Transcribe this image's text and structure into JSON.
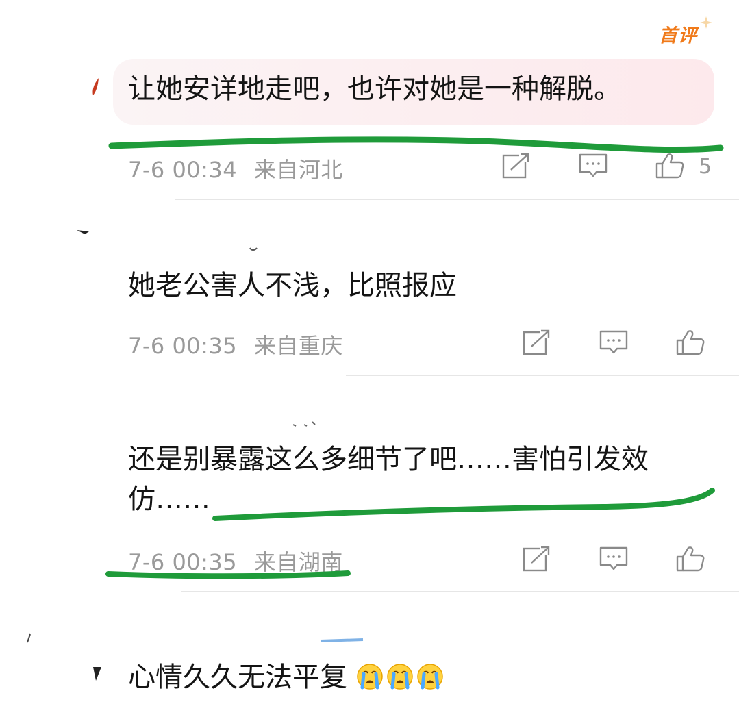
{
  "comments": [
    {
      "badge": "首评",
      "text": "让她安详地走吧，也许对她是一种解脱。",
      "time": "7-6 00:34",
      "location": "来自河北",
      "likes": "5"
    },
    {
      "text": "她老公害人不浅，比照报应",
      "time": "7-6 00:35",
      "location": "来自重庆"
    },
    {
      "text": "还是别暴露这么多细节了吧……害怕引发效仿……",
      "time": "7-6 00:35",
      "location": "来自湖南"
    },
    {
      "text": "心情久久无法平复",
      "emojis": [
        "crying-emoji",
        "crying-emoji",
        "crying-emoji"
      ]
    }
  ],
  "icons": {
    "share": "share-icon",
    "reply": "comment-icon",
    "like": "thumbs-up-icon"
  },
  "colors": {
    "badge": "#f07a1a",
    "annotation_marker": "#1f9b3a",
    "meta_text": "#9a9a9a",
    "highlight_bubble": "#fde9ec"
  }
}
